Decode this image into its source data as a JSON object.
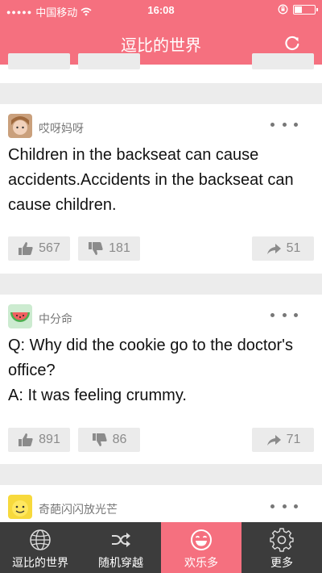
{
  "status_bar": {
    "carrier": "中国移动",
    "time": "16:08"
  },
  "header": {
    "title": "逗比的世界"
  },
  "posts": [
    {
      "author": "哎呀妈呀",
      "text": "Children in the backseat can cause accidents.Accidents in the backseat can cause children.",
      "likes": "567",
      "dislikes": "181",
      "shares": "51"
    },
    {
      "author": "中分命",
      "text": "Q: Why did the cookie go to the doctor's office?\nA: It was feeling crummy.",
      "likes": "891",
      "dislikes": "86",
      "shares": "71"
    },
    {
      "author": "奇葩闪闪放光芒"
    }
  ],
  "tabbar": {
    "tabs": [
      {
        "label": "逗比的世界",
        "icon": "globe-icon"
      },
      {
        "label": "随机穿越",
        "icon": "shuffle-icon"
      },
      {
        "label": "欢乐多",
        "icon": "smiley-icon",
        "active": true
      },
      {
        "label": "更多",
        "icon": "gear-icon"
      }
    ]
  },
  "colors": {
    "brand": "#f5707f",
    "tabbar": "#3c3c3c"
  }
}
